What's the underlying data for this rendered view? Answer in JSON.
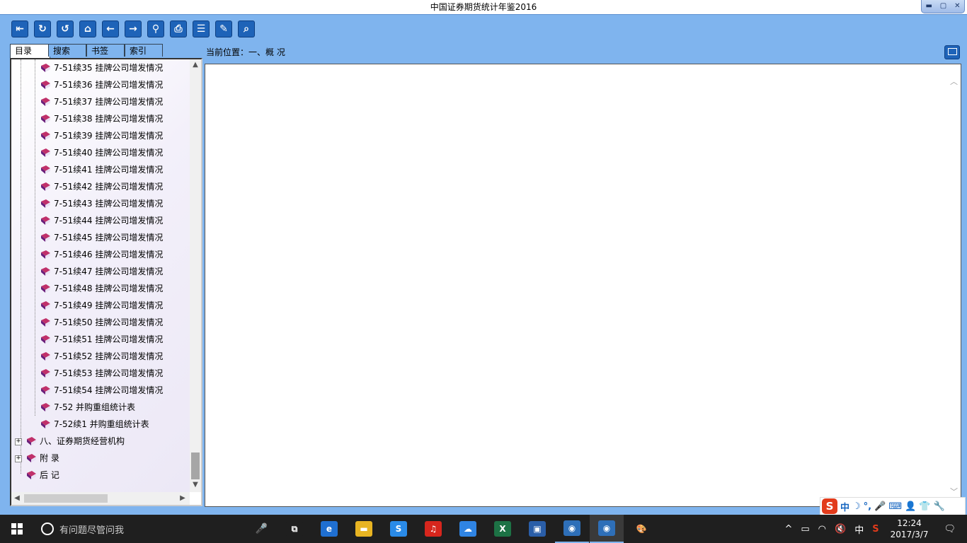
{
  "window": {
    "title": "中国证券期货统计年鉴2016",
    "min": "▬",
    "max": "▢",
    "close": "✕"
  },
  "toolbar": [
    {
      "name": "exit-icon",
      "glyph": "⇤"
    },
    {
      "name": "refresh-icon",
      "glyph": "↻"
    },
    {
      "name": "reload-icon",
      "glyph": "↺"
    },
    {
      "name": "home-icon",
      "glyph": "⌂"
    },
    {
      "name": "back-icon",
      "glyph": "←"
    },
    {
      "name": "forward-icon",
      "glyph": "→"
    },
    {
      "name": "search-icon",
      "glyph": "⚲"
    },
    {
      "name": "print-icon",
      "glyph": "⎙"
    },
    {
      "name": "notes-icon",
      "glyph": "☰"
    },
    {
      "name": "bookmark-icon",
      "glyph": "✎"
    },
    {
      "name": "doc-search-icon",
      "glyph": "⌕"
    }
  ],
  "tabs": {
    "catalog": "目录",
    "search": "搜索",
    "bookmarks": "书签",
    "index": "索引"
  },
  "tree": {
    "children": [
      "7-51续35 挂牌公司增发情况",
      "7-51续36 挂牌公司增发情况",
      "7-51续37 挂牌公司增发情况",
      "7-51续38 挂牌公司增发情况",
      "7-51续39 挂牌公司增发情况",
      "7-51续40 挂牌公司增发情况",
      "7-51续41 挂牌公司增发情况",
      "7-51续42 挂牌公司增发情况",
      "7-51续43 挂牌公司增发情况",
      "7-51续44 挂牌公司增发情况",
      "7-51续45 挂牌公司增发情况",
      "7-51续46 挂牌公司增发情况",
      "7-51续47 挂牌公司增发情况",
      "7-51续48 挂牌公司增发情况",
      "7-51续49 挂牌公司增发情况",
      "7-51续50 挂牌公司增发情况",
      "7-51续51 挂牌公司增发情况",
      "7-51续52 挂牌公司增发情况",
      "7-51续53 挂牌公司增发情况",
      "7-51续54 挂牌公司增发情况",
      "7-52 并购重组统计表",
      "7-52续1 并购重组统计表"
    ],
    "top": [
      "八、证券期货经营机构",
      "附  录",
      "后  记"
    ]
  },
  "location": {
    "label": "当前位置：一、概  况"
  },
  "ime": {
    "logo": "S",
    "items": [
      "中",
      "☽",
      "°,",
      "🎤",
      "⌨",
      "👤",
      "👕",
      "🔧"
    ]
  },
  "taskbar": {
    "search_placeholder": "有问题尽管问我",
    "mic": "🎤",
    "apps": [
      {
        "name": "task-view-icon",
        "glyph": "⧉",
        "color": "#1f1f1f"
      },
      {
        "name": "edge-icon",
        "glyph": "e",
        "color": "#1f6fd1"
      },
      {
        "name": "file-explorer-icon",
        "glyph": "▬",
        "color": "#e8b422"
      },
      {
        "name": "sogou-browser-icon",
        "glyph": "S",
        "color": "#2a8be8"
      },
      {
        "name": "netease-music-icon",
        "glyph": "♫",
        "color": "#d7261d"
      },
      {
        "name": "baidu-netdisk-icon",
        "glyph": "☁",
        "color": "#2f84e3"
      },
      {
        "name": "excel-icon",
        "glyph": "X",
        "color": "#1d7245"
      },
      {
        "name": "app-window-icon",
        "glyph": "▣",
        "color": "#2a5ea8"
      },
      {
        "name": "ebook-reader-icon",
        "glyph": "◉",
        "color": "#2e6fb8"
      },
      {
        "name": "ebook-reader-active-icon",
        "glyph": "◉",
        "color": "#2e6fb8"
      },
      {
        "name": "paint-icon",
        "glyph": "🎨",
        "color": "#1f1f1f"
      }
    ],
    "tray": {
      "chevron": "^",
      "battery": "▭",
      "wifi": "◠",
      "volume": "🔇",
      "lang": "中",
      "ime": "S"
    },
    "time": "12:24",
    "date": "2017/3/7",
    "notify": "🗨"
  }
}
